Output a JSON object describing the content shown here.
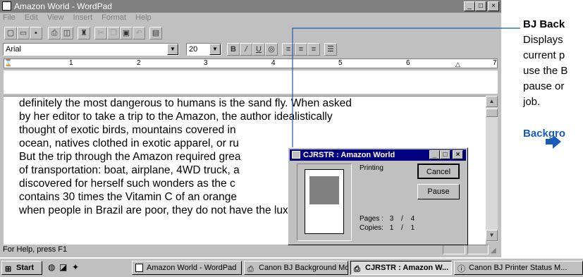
{
  "window": {
    "title": "Amazon World - WordPad",
    "menu": [
      "File",
      "Edit",
      "View",
      "Insert",
      "Format",
      "Help"
    ],
    "font_name": "Arial",
    "font_size": "20",
    "ruler_numbers": [
      "1",
      "2",
      "3",
      "4",
      "5",
      "6",
      "7"
    ],
    "status_text": "For Help, press F1"
  },
  "document": {
    "lines": [
      "definitely the most dangerous to humans is the sand fly.  When asked",
      "by her editor to take a trip to the Amazon, the author idealistically",
      "thought of exotic birds, mountains covered in",
      "ocean, natives clothed in exotic apparel, or ru",
      "But the trip through the Amazon required grea",
      "of transportation: boat, airplane, 4WD truck, a",
      "discovered for herself such wonders as the c",
      "contains 30 times the Vitamin C of an orange",
      "when people in Brazil are poor, they do not have the luxury of"
    ]
  },
  "dialog": {
    "title": "CJRSTR : Amazon World",
    "status": "Printing",
    "cancel_label": "Cancel",
    "pause_label": "Pause",
    "pages_label": "Pages :",
    "pages_current": "3",
    "pages_sep": "/",
    "pages_total": "4",
    "copies_label": "Copies:",
    "copies_current": "1",
    "copies_sep": "/",
    "copies_total": "1"
  },
  "annotation": {
    "heading": "BJ Back",
    "lines": [
      "Displays",
      "current p",
      "use the B",
      "pause or",
      "job."
    ],
    "link": "Backgro"
  },
  "taskbar": {
    "start_label": "Start",
    "tasks": [
      "Amazon World - WordPad",
      "Canon BJ Background Mo...",
      "CJRSTR : Amazon W...",
      "Canon BJ Printer Status M..."
    ]
  }
}
